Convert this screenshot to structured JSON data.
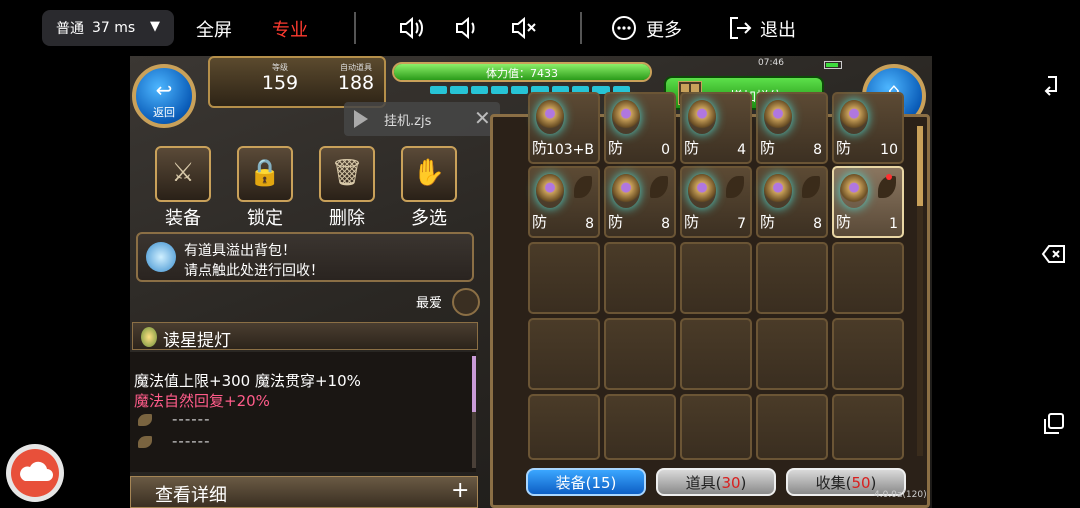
{
  "toolbar": {
    "quality": "普通",
    "latency": "37 ms",
    "fullscreen": "全屏",
    "pro": "专业",
    "more": "更多",
    "exit": "退出",
    "pro_color": "#ff3b30"
  },
  "game": {
    "back_label": "返回",
    "close_label": "关闭",
    "level_caption": "等级",
    "level": "159",
    "auto_caption": "自动道具",
    "auto_items": "188",
    "stamina_label": "体力值：7433",
    "add_slot": "增加栏位",
    "clock": "07:46",
    "file_name": "挂机.zjs",
    "actions": [
      {
        "label": "装备"
      },
      {
        "label": "锁定"
      },
      {
        "label": "删除"
      },
      {
        "label": "多选"
      }
    ],
    "notice_line1": "有道具溢出背包！",
    "notice_line2": "请点触此处进行回收！",
    "best": "最爱",
    "item_name": "读星提灯",
    "desc_line1": "魔法值上限+300  魔法贯穿+10%",
    "desc_line2": "魔法自然回复+20%",
    "dash": "------",
    "detail": "查看详细",
    "plus": "+",
    "inventory_row1": [
      {
        "fang": "防",
        "val": "103+B"
      },
      {
        "fang": "防",
        "val": "0"
      },
      {
        "fang": "防",
        "val": "4"
      },
      {
        "fang": "防",
        "val": "8"
      },
      {
        "fang": "防",
        "val": "10"
      }
    ],
    "inventory_row2": [
      {
        "fang": "防",
        "val": "8"
      },
      {
        "fang": "防",
        "val": "8"
      },
      {
        "fang": "防",
        "val": "7"
      },
      {
        "fang": "防",
        "val": "8"
      },
      {
        "fang": "防",
        "val": "1"
      }
    ],
    "tab_equip": "装备(15)",
    "tab_item_prefix": "道具(",
    "tab_item_count": "30",
    "tab_collect_prefix": "收集(",
    "tab_collect_count": "50",
    "tab_suffix": ")",
    "version": "4.0.0a(120)"
  }
}
